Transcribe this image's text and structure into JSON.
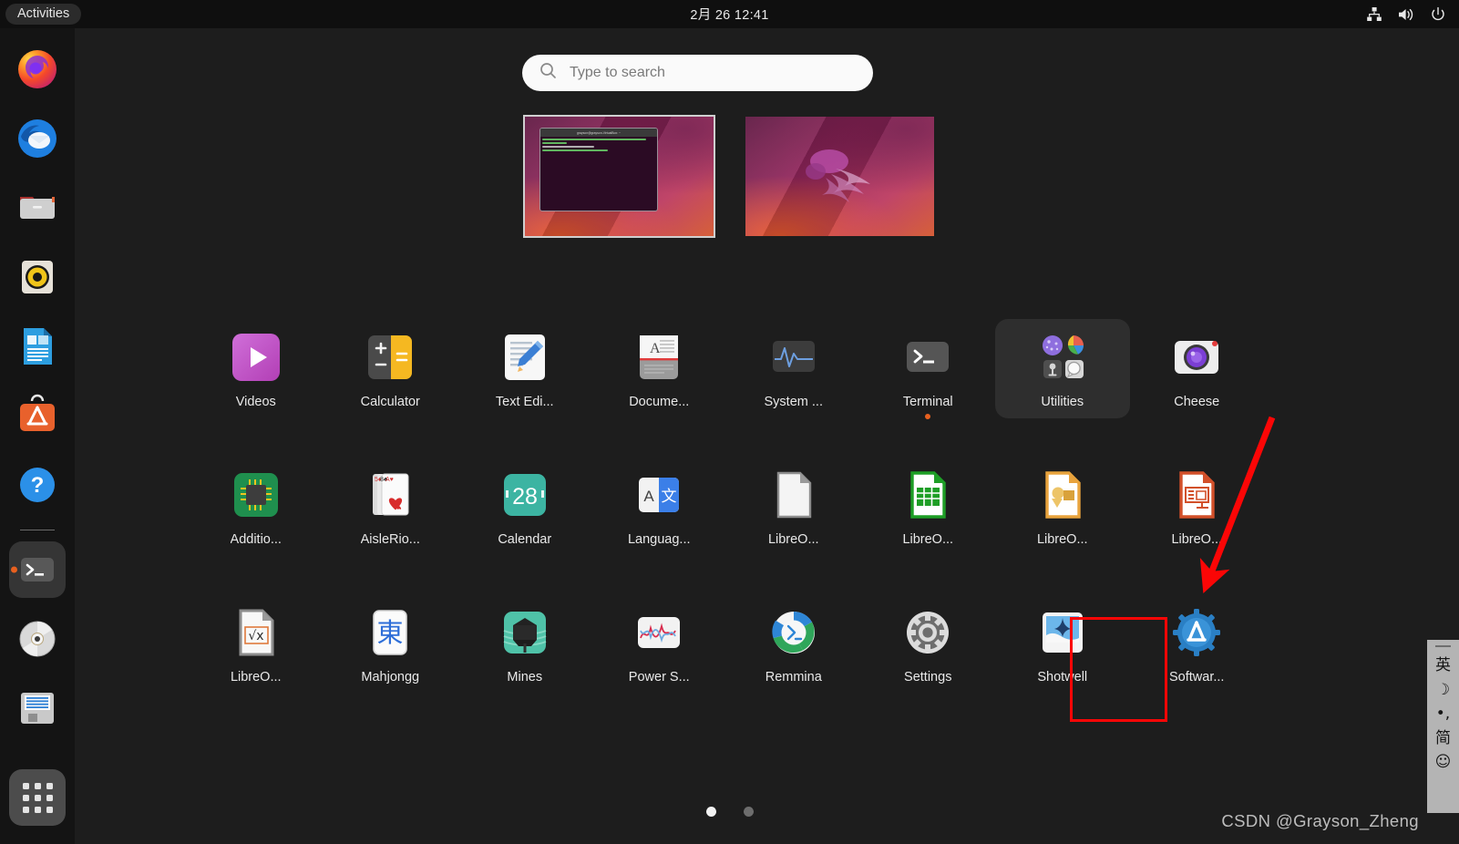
{
  "topbar": {
    "activities_label": "Activities",
    "clock": "2月 26  12:41",
    "tray": [
      {
        "name": "network-icon",
        "label": "Network"
      },
      {
        "name": "volume-icon",
        "label": "Volume"
      },
      {
        "name": "power-icon",
        "label": "Power"
      }
    ]
  },
  "search": {
    "placeholder": "Type to search",
    "value": "",
    "icon": "search-icon"
  },
  "workspaces": {
    "items": [
      {
        "name": "workspace-1",
        "active": true,
        "has_window": true,
        "window_title": "grayson@grayson-VirtualBox: ~"
      },
      {
        "name": "workspace-2",
        "active": false,
        "has_window": false
      }
    ]
  },
  "dock": {
    "items": [
      {
        "name": "dock-firefox",
        "label": "Firefox",
        "running": false
      },
      {
        "name": "dock-thunderbird",
        "label": "Thunderbird Mail",
        "running": false
      },
      {
        "name": "dock-files",
        "label": "Files",
        "running": false
      },
      {
        "name": "dock-rhythmbox",
        "label": "Rhythmbox",
        "running": false
      },
      {
        "name": "dock-libreoffice-writer",
        "label": "LibreOffice Writer",
        "running": false
      },
      {
        "name": "dock-ubuntu-software",
        "label": "Ubuntu Software",
        "running": false
      },
      {
        "name": "dock-help",
        "label": "Help",
        "running": false
      },
      {
        "name": "dock-terminal",
        "label": "Terminal",
        "running": true
      },
      {
        "name": "dock-cd-drive",
        "label": "CD/DVD Drive",
        "running": false
      },
      {
        "name": "dock-disk-image",
        "label": "Disk Image",
        "running": false
      }
    ],
    "show_apps_label": "Show Applications"
  },
  "app_grid": {
    "rows": [
      [
        {
          "name": "app-videos",
          "label": "Videos",
          "icon": "videos-icon",
          "running": false,
          "folder": false
        },
        {
          "name": "app-calculator",
          "label": "Calculator",
          "icon": "calculator-icon",
          "running": false,
          "folder": false
        },
        {
          "name": "app-text-editor",
          "label": "Text Edi...",
          "icon": "text-editor-icon",
          "running": false,
          "folder": false
        },
        {
          "name": "app-documents",
          "label": "Docume...",
          "icon": "documents-icon",
          "running": false,
          "folder": false
        },
        {
          "name": "app-system-monitor",
          "label": "System ...",
          "icon": "system-monitor-icon",
          "running": false,
          "folder": false
        },
        {
          "name": "app-terminal",
          "label": "Terminal",
          "icon": "terminal-icon",
          "running": true,
          "folder": false
        },
        {
          "name": "app-folder-utilities",
          "label": "Utilities",
          "icon": "utilities-folder-icon",
          "running": false,
          "folder": true
        },
        {
          "name": "app-cheese",
          "label": "Cheese",
          "icon": "cheese-icon",
          "running": false,
          "folder": false
        }
      ],
      [
        {
          "name": "app-additional-drivers",
          "label": "Additio...",
          "icon": "additional-drivers-icon",
          "running": false,
          "folder": false
        },
        {
          "name": "app-aisleriot",
          "label": "AisleRio...",
          "icon": "aisleriot-icon",
          "running": false,
          "folder": false
        },
        {
          "name": "app-calendar",
          "label": "Calendar",
          "icon": "calendar-icon",
          "running": false,
          "folder": false
        },
        {
          "name": "app-language-selector",
          "label": "Languag...",
          "icon": "language-selector-icon",
          "running": false,
          "folder": false
        },
        {
          "name": "app-libreoffice-start",
          "label": "LibreO...",
          "icon": "libreoffice-start-icon",
          "running": false,
          "folder": false
        },
        {
          "name": "app-libreoffice-calc",
          "label": "LibreO...",
          "icon": "libreoffice-calc-icon",
          "running": false,
          "folder": false
        },
        {
          "name": "app-libreoffice-draw",
          "label": "LibreO...",
          "icon": "libreoffice-draw-icon",
          "running": false,
          "folder": false
        },
        {
          "name": "app-libreoffice-impress",
          "label": "LibreO...",
          "icon": "libreoffice-impress-icon",
          "running": false,
          "folder": false
        }
      ],
      [
        {
          "name": "app-libreoffice-math",
          "label": "LibreO...",
          "icon": "libreoffice-math-icon",
          "running": false,
          "folder": false
        },
        {
          "name": "app-mahjongg",
          "label": "Mahjongg",
          "icon": "mahjongg-icon",
          "running": false,
          "folder": false
        },
        {
          "name": "app-mines",
          "label": "Mines",
          "icon": "mines-icon",
          "running": false,
          "folder": false
        },
        {
          "name": "app-power-statistics",
          "label": "Power S...",
          "icon": "power-statistics-icon",
          "running": false,
          "folder": false
        },
        {
          "name": "app-remmina",
          "label": "Remmina",
          "icon": "remmina-icon",
          "running": false,
          "folder": false
        },
        {
          "name": "app-settings",
          "label": "Settings",
          "icon": "settings-icon",
          "running": false,
          "folder": false
        },
        {
          "name": "app-shotwell",
          "label": "Shotwell",
          "icon": "shotwell-icon",
          "running": false,
          "folder": false
        },
        {
          "name": "app-software",
          "label": "Softwar...",
          "icon": "software-icon",
          "running": false,
          "folder": false,
          "highlighted": true
        }
      ]
    ]
  },
  "page_indicator": {
    "pages": 2,
    "current": 1
  },
  "ime_panel": {
    "items": [
      {
        "name": "ime-language-toggle",
        "glyph": "英"
      },
      {
        "name": "ime-moon-mode-icon",
        "glyph": "☽"
      },
      {
        "name": "ime-punctuation-icon",
        "glyph": "•,"
      },
      {
        "name": "ime-simplified-toggle",
        "glyph": "简"
      },
      {
        "name": "ime-emoji-icon",
        "glyph": "☺"
      }
    ]
  },
  "annotations": {
    "arrow_color": "#fb0606",
    "box_color": "#fb0606",
    "highlight_target": "Softwar..."
  },
  "watermark": {
    "text": "CSDN @Grayson_Zheng"
  }
}
